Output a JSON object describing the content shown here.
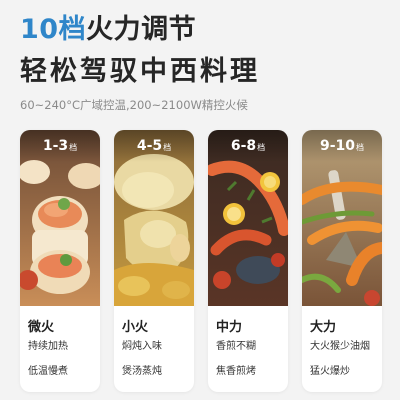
{
  "headline": {
    "accent": "10档",
    "main": "火力调节"
  },
  "subheadline": "轻松驾驭中西料理",
  "spec": "60~240°C广域控温,200~2100W精控火候",
  "cards": [
    {
      "range": "1-3",
      "unit": "档",
      "level": "微火",
      "line1": "持续加热",
      "line2": "低温慢煮",
      "photo": "shrimp-dish-image"
    },
    {
      "range": "4-5",
      "unit": "档",
      "level": "小火",
      "line1": "焖炖入味",
      "line2": "煲汤蒸炖",
      "photo": "chicken-dish-image"
    },
    {
      "range": "6-8",
      "unit": "档",
      "level": "中力",
      "line1": "香煎不糊",
      "line2": "焦香煎烤",
      "photo": "seafood-pan-image"
    },
    {
      "range": "9-10",
      "unit": "档",
      "level": "大力",
      "line1": "大火猴少油烟",
      "line2": "猛火爆炒",
      "photo": "stir-fry-image"
    }
  ],
  "colors": {
    "accent": "#2f86c9",
    "text": "#262626",
    "muted": "#8a8a8a",
    "background": "#f3f3f3",
    "card": "#ffffff"
  }
}
